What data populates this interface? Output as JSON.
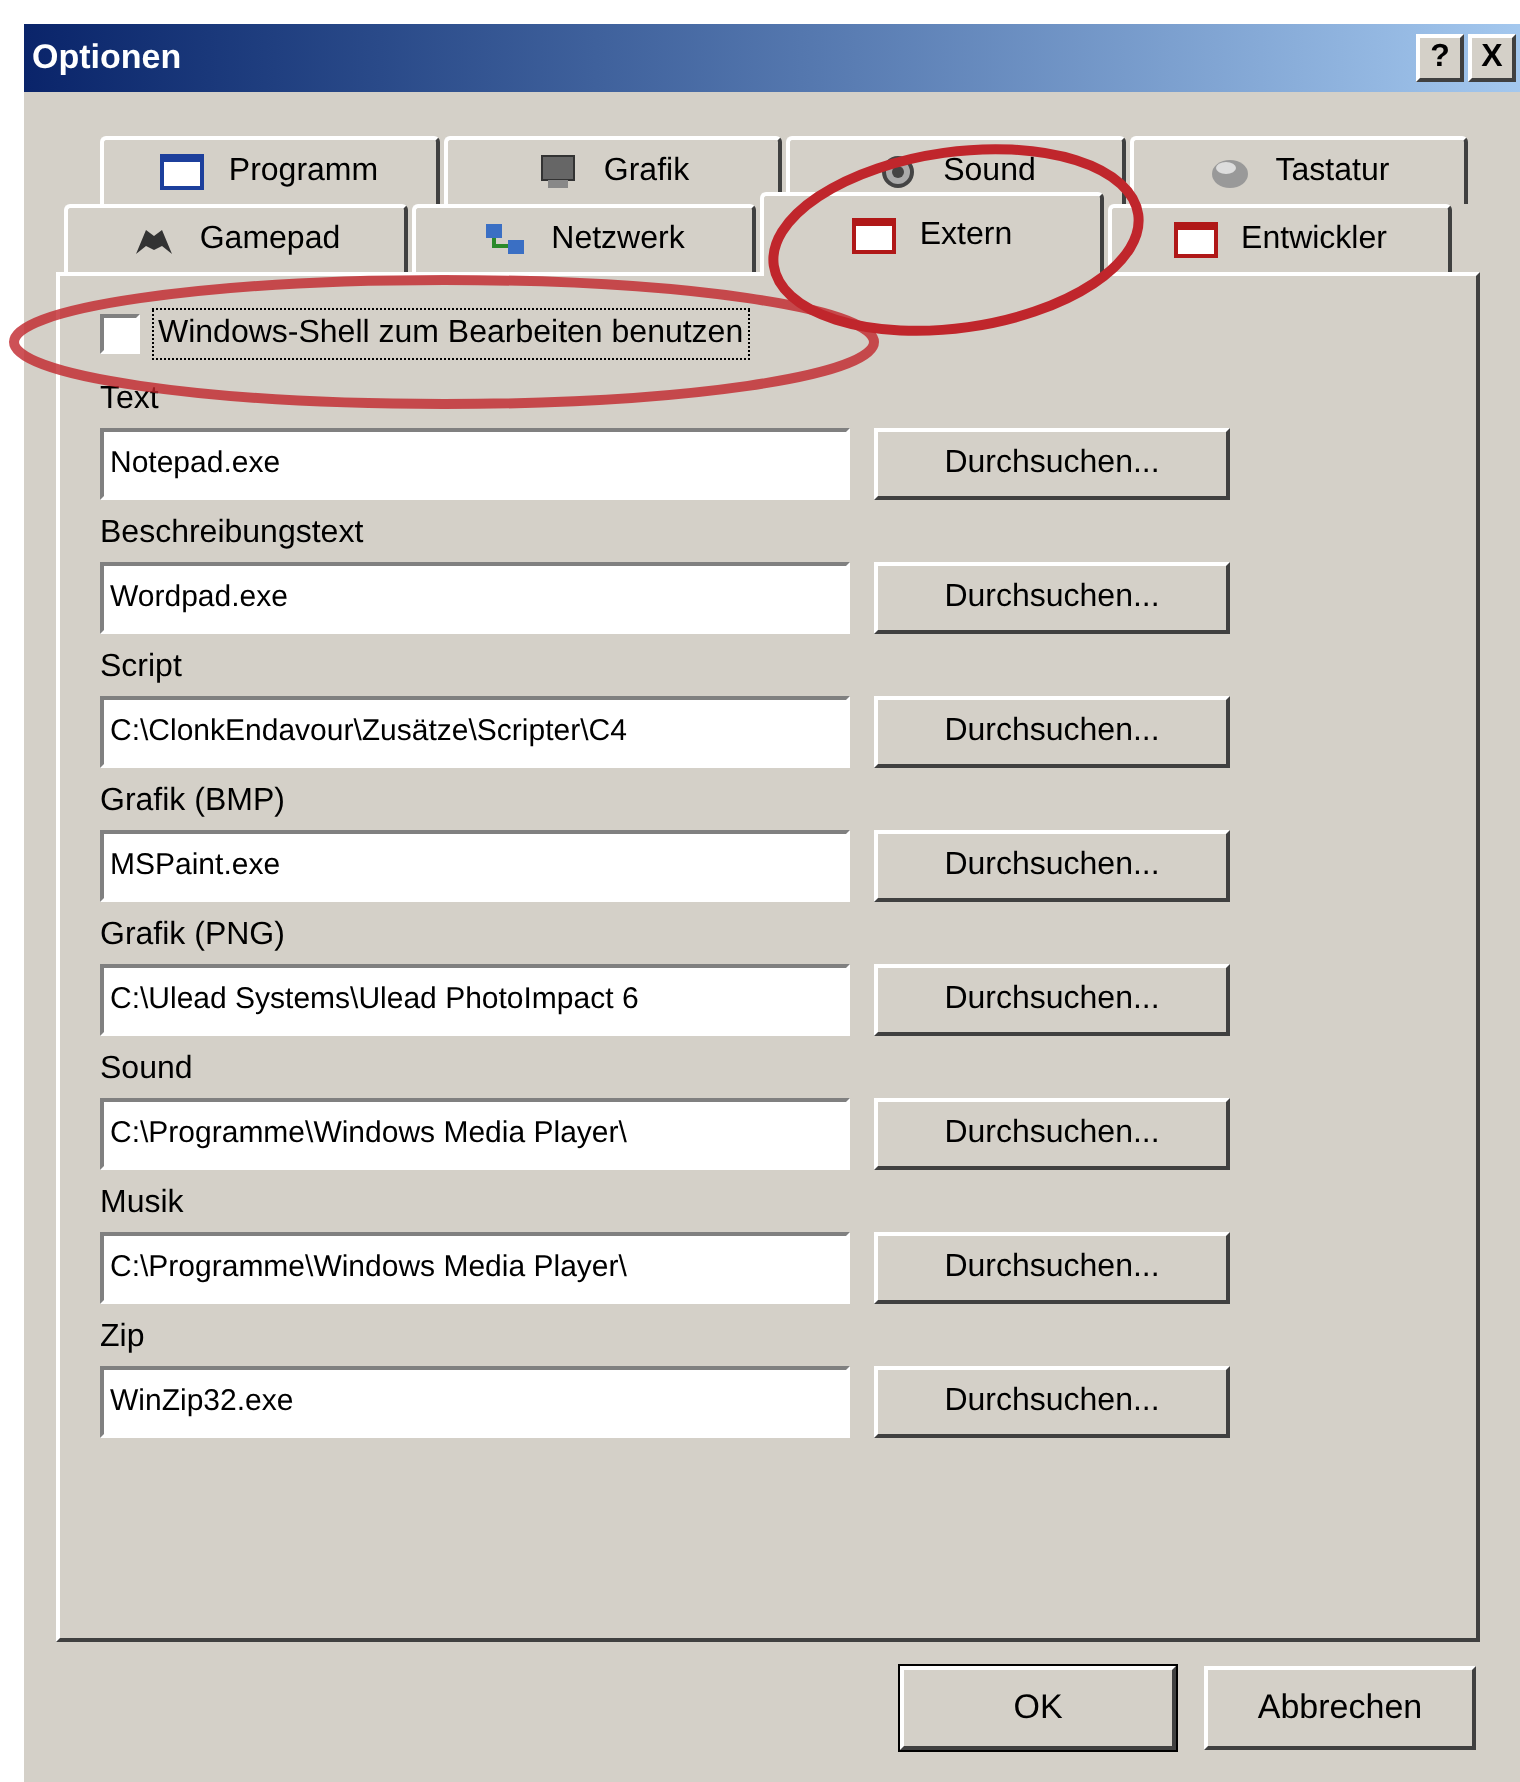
{
  "window": {
    "title": "Optionen",
    "help_button": "?",
    "close_button": "X"
  },
  "tabs": [
    [
      {
        "label": "Programm",
        "selected": false
      },
      {
        "label": "Grafik",
        "selected": false
      },
      {
        "label": "Sound",
        "selected": false
      },
      {
        "label": "Tastatur",
        "selected": false
      }
    ],
    [
      {
        "label": "Gamepad",
        "selected": false
      },
      {
        "label": "Netzwerk",
        "selected": false
      },
      {
        "label": "Extern",
        "selected": true
      },
      {
        "label": "Entwickler",
        "selected": false
      }
    ]
  ],
  "shell_checkbox": {
    "label": "Windows-Shell zum Bearbeiten benutzen",
    "checked": false
  },
  "programs": [
    {
      "label": "Text",
      "value": "Notepad.exe",
      "button": "Durchsuchen..."
    },
    {
      "label": "Beschreibungstext",
      "value": "Wordpad.exe",
      "button": "Durchsuchen..."
    },
    {
      "label": "Script",
      "value": "C:\\ClonkEndavour\\Zusätze\\Scripter\\C4",
      "button": "Durchsuchen..."
    },
    {
      "label": "Grafik (BMP)",
      "value": "MSPaint.exe",
      "button": "Durchsuchen..."
    },
    {
      "label": "Grafik (PNG)",
      "value": "C:\\Ulead Systems\\Ulead PhotoImpact 6",
      "button": "Durchsuchen..."
    },
    {
      "label": "Sound",
      "value": "C:\\Programme\\Windows Media Player\\",
      "button": "Durchsuchen..."
    },
    {
      "label": "Musik",
      "value": "C:\\Programme\\Windows Media Player\\",
      "button": "Durchsuchen..."
    },
    {
      "label": "Zip",
      "value": "WinZip32.exe",
      "button": "Durchsuchen..."
    }
  ],
  "buttons": [
    "OK",
    "Abbrechen"
  ]
}
